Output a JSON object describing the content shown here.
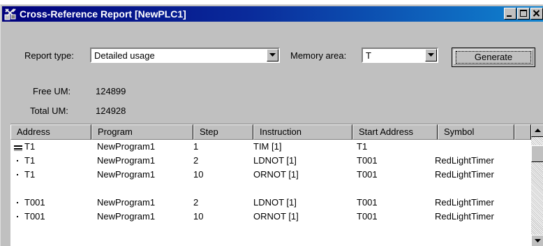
{
  "window": {
    "title": "Cross-Reference Report [NewPLC1]"
  },
  "controls": {
    "report_type_label": "Report type:",
    "report_type_value": "Detailed usage",
    "memory_area_label": "Memory area:",
    "memory_area_value": "T",
    "generate_label": "Generate",
    "free_um_label": "Free UM:",
    "free_um_value": "124899",
    "total_um_label": "Total UM:",
    "total_um_value": "124928"
  },
  "table": {
    "columns": [
      "Address",
      "Program",
      "Step",
      "Instruction",
      "Start Address",
      "Symbol"
    ],
    "rows": [
      {
        "marker": "bars",
        "address": "T1",
        "program": "NewProgram1",
        "step": "1",
        "instruction": "TIM [1]",
        "start_address": "T1",
        "symbol": ""
      },
      {
        "marker": "dot",
        "address": "T1",
        "program": "NewProgram1",
        "step": "2",
        "instruction": "LDNOT [1]",
        "start_address": "T001",
        "symbol": "RedLightTimer"
      },
      {
        "marker": "dot",
        "address": "T1",
        "program": "NewProgram1",
        "step": "10",
        "instruction": "ORNOT [1]",
        "start_address": "T001",
        "symbol": "RedLightTimer"
      },
      {
        "marker": "none",
        "address": "",
        "program": "",
        "step": "",
        "instruction": "",
        "start_address": "",
        "symbol": ""
      },
      {
        "marker": "dot",
        "address": "T001",
        "program": "NewProgram1",
        "step": "2",
        "instruction": "LDNOT [1]",
        "start_address": "T001",
        "symbol": "RedLightTimer"
      },
      {
        "marker": "dot",
        "address": "T001",
        "program": "NewProgram1",
        "step": "10",
        "instruction": "ORNOT [1]",
        "start_address": "T001",
        "symbol": "RedLightTimer"
      }
    ]
  },
  "colors": {
    "titlebar": "#00007c",
    "face": "#c0c0c0"
  }
}
